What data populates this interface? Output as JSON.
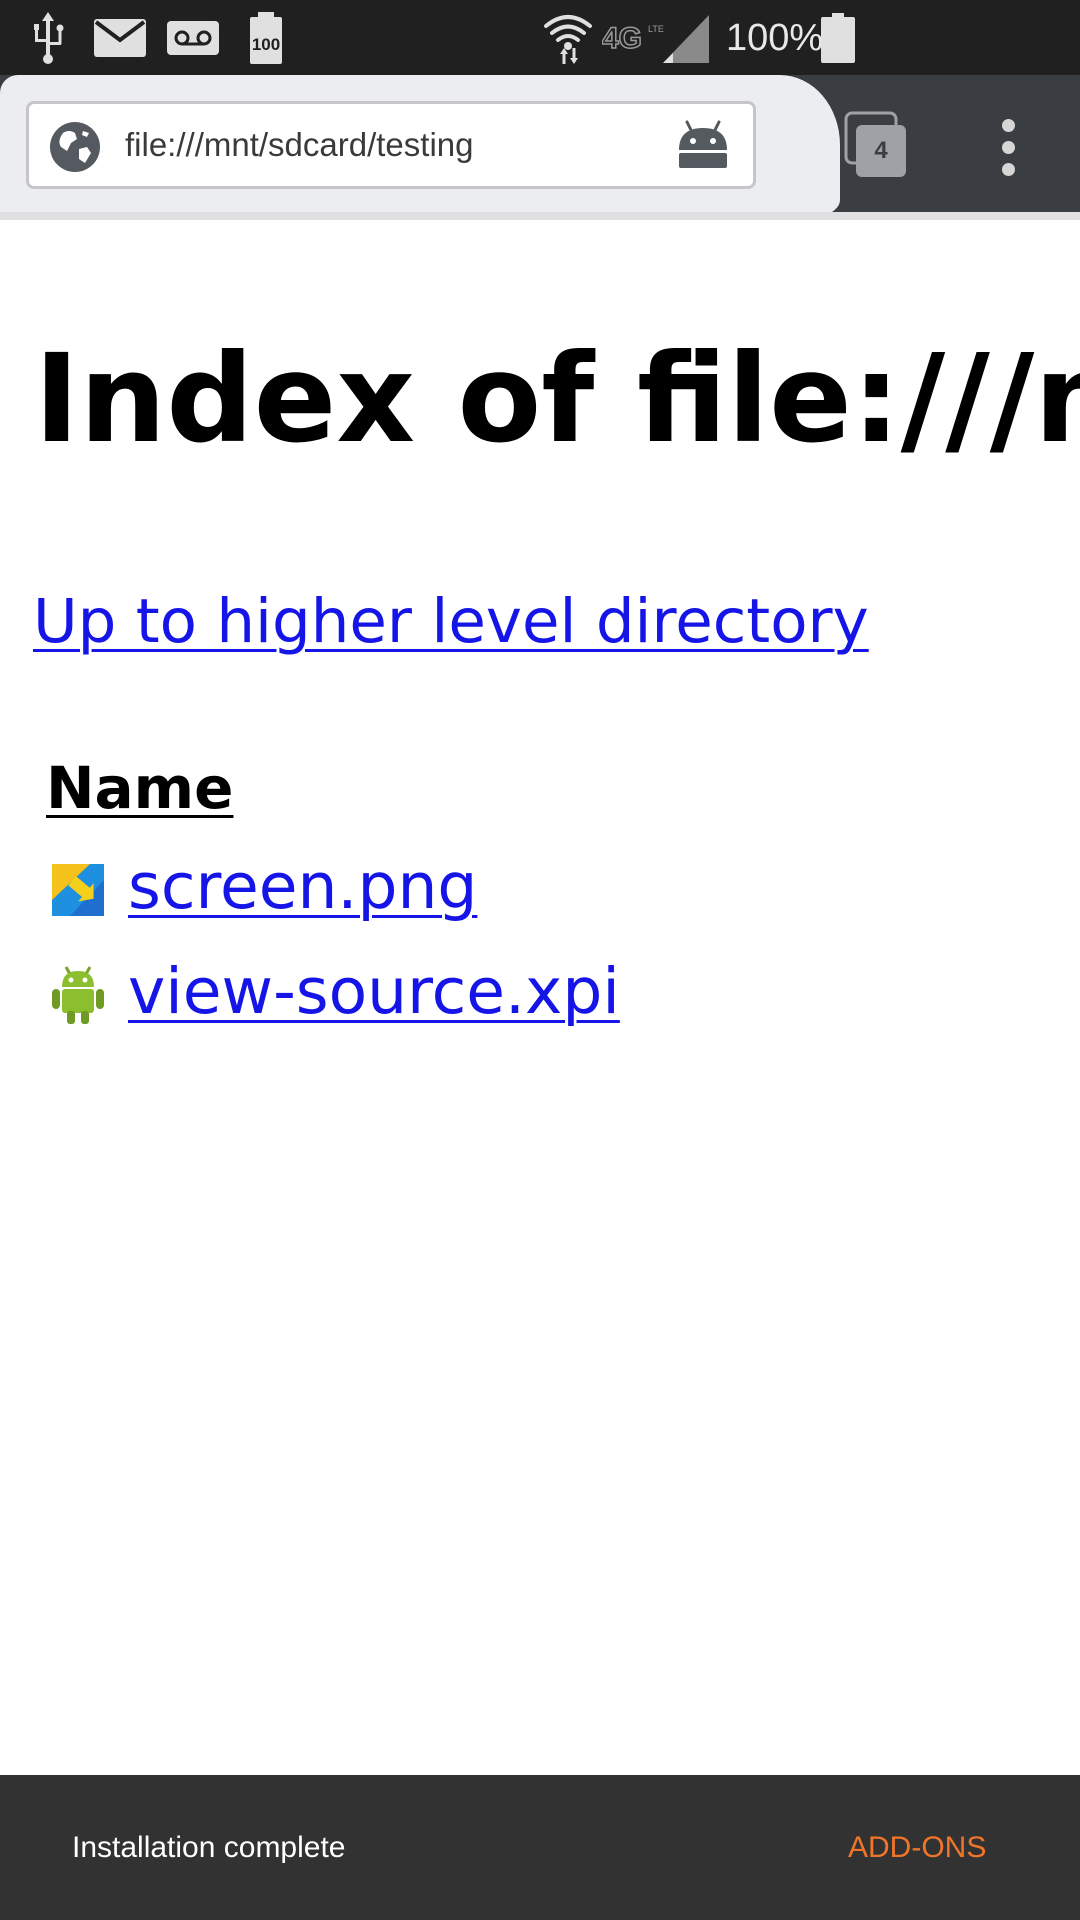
{
  "status_bar": {
    "icons": [
      "usb-icon",
      "mail-icon",
      "voicemail-icon",
      "battery-100-notification-icon",
      "wifi-icon",
      "lte-4g-icon",
      "cell-signal-icon",
      "battery-icon"
    ],
    "battery_badge": "100",
    "network_label": "4G",
    "battery_percent": "100%"
  },
  "toolbar": {
    "url": "file:///mnt/sdcard/testing",
    "tab_count": "4",
    "site_icon": "globe-icon",
    "addon_icon": "android-icon",
    "menu_icon": "overflow-menu-icon"
  },
  "page": {
    "title": "Index of file:///mnt/sdcard/testing",
    "up_link": "Up to higher level directory",
    "column_header": "Name",
    "files": [
      {
        "name": "screen.png",
        "icon": "image-file-icon"
      },
      {
        "name": "view-source.xpi",
        "icon": "android-file-icon"
      }
    ]
  },
  "snackbar": {
    "message": "Installation complete",
    "action": "ADD-ONS"
  },
  "colors": {
    "link": "#1515e8",
    "snackbar_bg": "#323232",
    "snackbar_action": "#f07528",
    "toolbar_bg": "#3a3d41",
    "urltab_bg": "#ecedf0"
  }
}
